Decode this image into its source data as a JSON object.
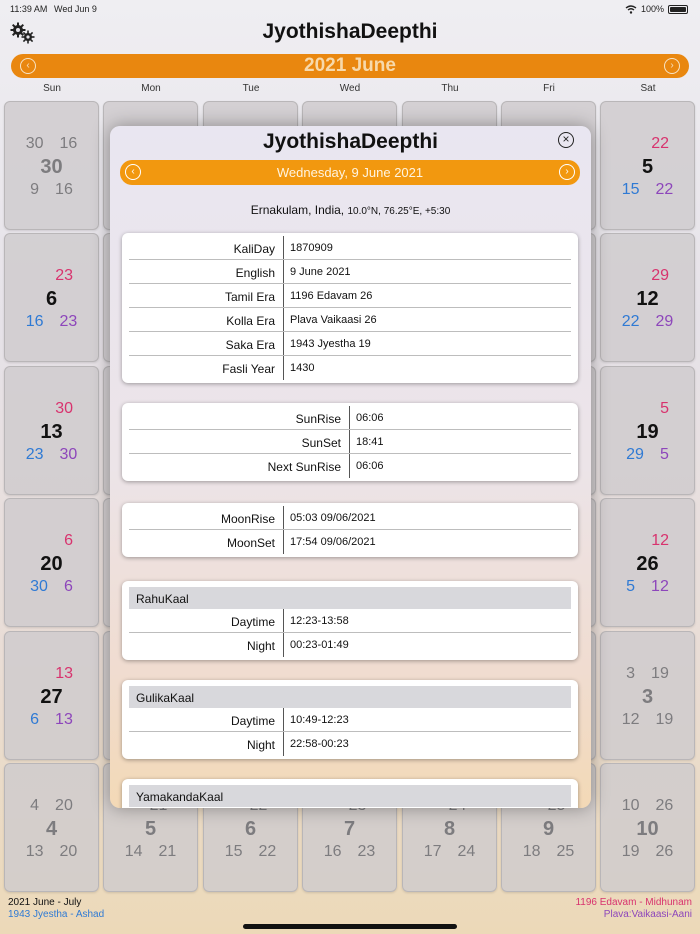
{
  "status_bar": {
    "time": "11:39 AM",
    "date": "Wed Jun 9",
    "battery": "100%"
  },
  "header": {
    "title": "JyothishaDeepthi",
    "settings_icon": "gears-icon"
  },
  "month_bar": {
    "label": "2021 June",
    "prev_icon": "chevron-left-icon",
    "next_icon": "chevron-right-icon"
  },
  "weekdays": [
    "Sun",
    "Mon",
    "Tue",
    "Wed",
    "Thu",
    "Fri",
    "Sat"
  ],
  "calendar": {
    "rows": [
      [
        {
          "top": [
            "30",
            "16"
          ],
          "mid": "30",
          "bot": [
            "9",
            "16"
          ],
          "style": "grey"
        },
        null,
        null,
        null,
        null,
        null,
        {
          "top": [
            "22"
          ],
          "mid": "5",
          "bot": [
            "15",
            "22"
          ],
          "style": "color"
        }
      ],
      [
        {
          "top": [
            "23"
          ],
          "mid": "6",
          "bot": [
            "16",
            "23"
          ],
          "style": "color"
        },
        null,
        null,
        null,
        null,
        null,
        {
          "top": [
            "29"
          ],
          "mid": "12",
          "bot": [
            "22",
            "29"
          ],
          "style": "color"
        }
      ],
      [
        {
          "top": [
            "30"
          ],
          "mid": "13",
          "bot": [
            "23",
            "30"
          ],
          "style": "color"
        },
        null,
        null,
        null,
        null,
        null,
        {
          "top": [
            "5"
          ],
          "mid": "19",
          "bot": [
            "29",
            "5"
          ],
          "style": "color"
        }
      ],
      [
        {
          "top": [
            "6"
          ],
          "mid": "20",
          "bot": [
            "30",
            "6"
          ],
          "style": "color"
        },
        null,
        null,
        null,
        null,
        null,
        {
          "top": [
            "12"
          ],
          "mid": "26",
          "bot": [
            "5",
            "12"
          ],
          "style": "color"
        }
      ],
      [
        {
          "top": [
            "13"
          ],
          "mid": "27",
          "bot": [
            "6",
            "13"
          ],
          "style": "color"
        },
        null,
        null,
        null,
        null,
        null,
        {
          "top": [
            "3",
            "19"
          ],
          "mid": "3",
          "bot": [
            "12",
            "19"
          ],
          "style": "grey"
        }
      ],
      [
        {
          "top": [
            "4",
            "20"
          ],
          "mid": "4",
          "bot": [
            "13",
            "20"
          ],
          "style": "grey"
        },
        {
          "top": [
            "",
            "21"
          ],
          "mid": "5",
          "bot": [
            "14",
            "21"
          ],
          "style": "grey"
        },
        {
          "top": [
            "",
            "22"
          ],
          "mid": "6",
          "bot": [
            "15",
            "22"
          ],
          "style": "grey"
        },
        {
          "top": [
            "",
            "23"
          ],
          "mid": "7",
          "bot": [
            "16",
            "23"
          ],
          "style": "grey"
        },
        {
          "top": [
            "",
            "24"
          ],
          "mid": "8",
          "bot": [
            "17",
            "24"
          ],
          "style": "grey"
        },
        {
          "top": [
            "",
            "25"
          ],
          "mid": "9",
          "bot": [
            "18",
            "25"
          ],
          "style": "grey"
        },
        {
          "top": [
            "10",
            "26"
          ],
          "mid": "10",
          "bot": [
            "19",
            "26"
          ],
          "style": "grey"
        }
      ]
    ]
  },
  "footer": {
    "left_line1": "2021 June - July",
    "left_line2": "1943 Jyestha - Ashad",
    "right_line1": "1196 Edavam - Midhunam",
    "right_line2": "Plava:Vaikaasi-Aani"
  },
  "modal": {
    "title": "JyothishaDeepthi",
    "close_icon": "close-circle-icon",
    "date_label": "Wednesday, 9 June 2021",
    "location": "Ernakulam, India,",
    "coords": "10.0°N, 76.25°E, +5:30",
    "eras": [
      {
        "k": "KaliDay",
        "v": "1870909"
      },
      {
        "k": "English",
        "v": "9 June  2021"
      },
      {
        "k": "Tamil Era",
        "v": "1196 Edavam 26"
      },
      {
        "k": "Kolla Era",
        "v": "Plava Vaikaasi 26"
      },
      {
        "k": "Saka Era",
        "v": "1943 Jyestha 19"
      },
      {
        "k": "Fasli Year",
        "v": "1430"
      }
    ],
    "sun": [
      {
        "k": "SunRise",
        "v": "06:06"
      },
      {
        "k": "SunSet",
        "v": "18:41"
      },
      {
        "k": "Next SunRise",
        "v": "06:06"
      }
    ],
    "moon": [
      {
        "k": "MoonRise",
        "v": "05:03 09/06/2021"
      },
      {
        "k": "MoonSet",
        "v": "17:54 09/06/2021"
      }
    ],
    "rahu": {
      "title": "RahuKaal",
      "rows": [
        {
          "k": "Daytime",
          "v": "12:23-13:58"
        },
        {
          "k": "Night",
          "v": "00:23-01:49"
        }
      ]
    },
    "gulika": {
      "title": "GulikaKaal",
      "rows": [
        {
          "k": "Daytime",
          "v": "10:49-12:23"
        },
        {
          "k": "Night",
          "v": "22:58-00:23"
        }
      ]
    },
    "yamakanda": {
      "title": "YamakandaKaal"
    }
  },
  "colors": {
    "accent_orange": "#e9870f",
    "modal_orange": "#f2980f",
    "pink": "#d8336e",
    "blue": "#2f7ad4",
    "purple": "#8d46bb"
  }
}
